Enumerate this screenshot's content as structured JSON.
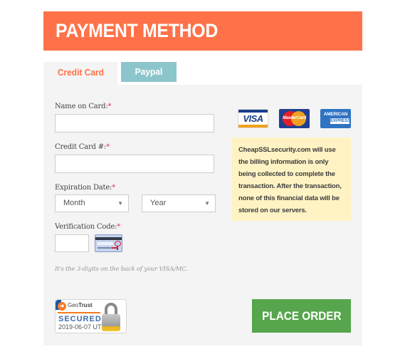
{
  "header": {
    "title": "PAYMENT METHOD"
  },
  "tabs": [
    {
      "label": "Credit Card",
      "active": true
    },
    {
      "label": "Paypal",
      "active": false
    }
  ],
  "form": {
    "name_on_card": {
      "label": "Name on Card:",
      "required_mark": "*",
      "value": ""
    },
    "card_number": {
      "label": "Credit Card #:",
      "required_mark": "*",
      "value": ""
    },
    "expiration": {
      "label": "Expiration Date:",
      "required_mark": "*",
      "month": {
        "selected": "Month"
      },
      "year": {
        "selected": "Year"
      }
    },
    "cvv": {
      "label": "Verification Code:",
      "required_mark": "*",
      "value": ""
    },
    "cvv_hint": "It's the 3-digits on the back of your VISA/MC."
  },
  "cards": [
    {
      "name": "visa",
      "label": "VISA"
    },
    {
      "name": "mastercard",
      "label": "MasterCard"
    },
    {
      "name": "amex",
      "label_top": "AMERICAN",
      "label_bottom": "EXPRESS"
    }
  ],
  "notice": "CheapSSLsecurity.com will use the billing information is only being collected to complete the transaction. After the transaction, none of this financial data will be stored on our servers.",
  "seal": {
    "brand_a": "Geo",
    "brand_b": "Trust",
    "status": "SECURED",
    "date": "2019-06-07 UTC"
  },
  "actions": {
    "place_order": "PLACE ORDER"
  },
  "colors": {
    "accent": "#ff7249",
    "paypal_tab": "#8cc6cc",
    "panel": "#f4f4f4",
    "notice_bg": "#fff3c4",
    "submit": "#57a54d",
    "required": "#e8334a"
  }
}
